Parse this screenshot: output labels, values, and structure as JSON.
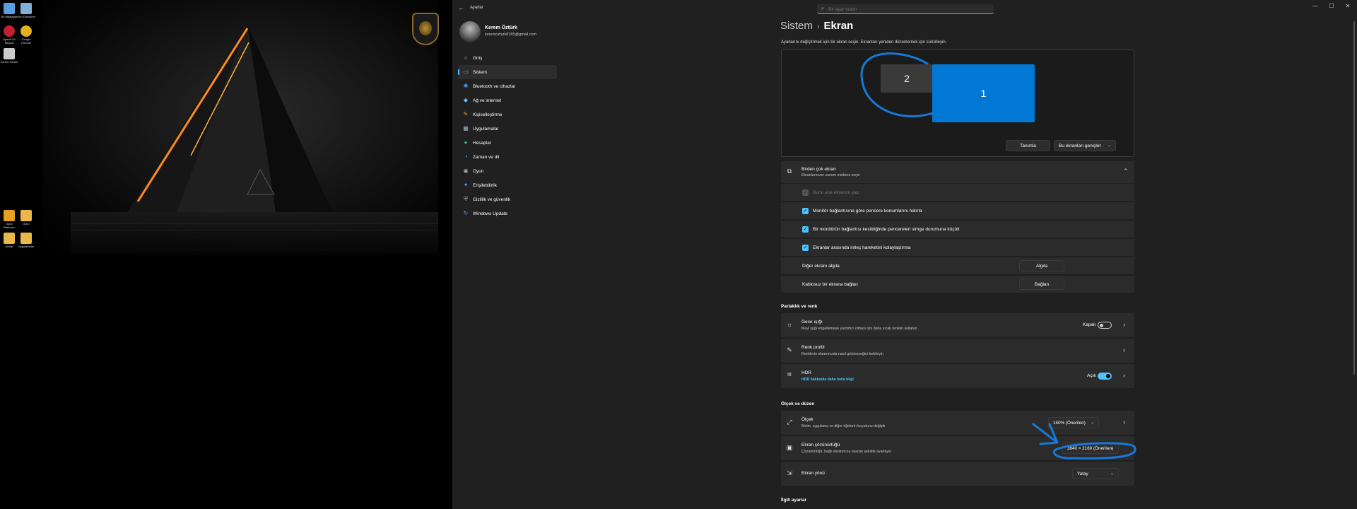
{
  "desktop": {
    "icons": [
      {
        "label": "Bu bilgisayar",
        "color": "#5aa0e0"
      },
      {
        "label": "Geri Dönüşüm",
        "color": "#7fb0d8"
      },
      {
        "label": "Opera GX Tarayıcı",
        "color": "#c2222f"
      },
      {
        "label": "Google Chrome",
        "color": "#e0b020"
      },
      {
        "label": "Kerem Ozturk",
        "color": "#cccccc"
      },
      {
        "label": "Oyun Platformu",
        "color": "#e8a020"
      },
      {
        "label": "Oyun",
        "color": "#e8b84a"
      },
      {
        "label": "Notlar",
        "color": "#e8b84a"
      },
      {
        "label": "Uygulamalar",
        "color": "#e8b84a"
      }
    ]
  },
  "window": {
    "title": "Ayarlar",
    "search_placeholder": "Bir ayar bulun",
    "controls": {
      "minimize": "—",
      "maximize": "☐",
      "close": "✕"
    }
  },
  "profile": {
    "name": "Kerem Öztürk",
    "email": "keremozturk8155@gmail.com"
  },
  "nav": [
    {
      "label": "Giriş",
      "icon": "home-icon",
      "glyph": "⌂",
      "color": "#e8a040"
    },
    {
      "label": "Sistem",
      "icon": "system-icon",
      "glyph": "▭",
      "color": "#4cc2ff",
      "active": true
    },
    {
      "label": "Bluetooth ve cihazlar",
      "icon": "bluetooth-icon",
      "glyph": "✱",
      "color": "#4c9cff"
    },
    {
      "label": "Ağ ve internet",
      "icon": "wifi-icon",
      "glyph": "◆",
      "color": "#6cb8ff"
    },
    {
      "label": "Kişiselleştirme",
      "icon": "brush-icon",
      "glyph": "✎",
      "color": "#f0a030"
    },
    {
      "label": "Uygulamalar",
      "icon": "apps-icon",
      "glyph": "▦",
      "color": "#9bb0c8"
    },
    {
      "label": "Hesaplar",
      "icon": "person-icon",
      "glyph": "●",
      "color": "#40c880"
    },
    {
      "label": "Zaman ve dil",
      "icon": "globe-clock-icon",
      "glyph": "◔",
      "color": "#4cc2ff"
    },
    {
      "label": "Oyun",
      "icon": "gamepad-icon",
      "glyph": "◉",
      "color": "#aaaaaa"
    },
    {
      "label": "Erişilebilirlik",
      "icon": "accessibility-icon",
      "glyph": "✦",
      "color": "#4c9cff"
    },
    {
      "label": "Gizlilik ve güvenlik",
      "icon": "shield-icon",
      "glyph": "⛨",
      "color": "#aaaaaa"
    },
    {
      "label": "Windows Update",
      "icon": "update-icon",
      "glyph": "↻",
      "color": "#4c9cff"
    }
  ],
  "breadcrumb": {
    "parent": "Sistem",
    "separator": "›",
    "current": "Ekran"
  },
  "hint": "Ayarlarını değiştirmek için bir ekran seçin. Ekranları yeniden düzenlemek için sürükleyin.",
  "monitors": {
    "m2": "2",
    "m1": "1",
    "identify": "Tanımla",
    "extend": "Bu ekranları genişlet"
  },
  "multi_display": {
    "title": "Birden çok ekran",
    "subtitle": "Ekranlarınızın sunum modunu seçin",
    "make_main": "Bunu ana ekranım yap",
    "remember_windows": "Monitör bağlantısına göre pencere konumlarını hatırla",
    "minimize_windows": "Bir monitörün bağlantısı kesildiğinde pencereleri simge durumuna küçült",
    "ease_cursor": "Ekranlar arasında imleç hareketini kolaylaştırma",
    "detect_label": "Diğer ekranı algıla",
    "detect_button": "Algıla",
    "wireless_label": "Kablosuz bir ekrana bağlan",
    "wireless_button": "Bağlan"
  },
  "brightness_section": "Parlaklık ve renk",
  "night_light": {
    "title": "Gece ışığı",
    "subtitle": "Mavi ışığı engellemeye yardımcı olması için daha sıcak renkler kullanın",
    "state": "Kapalı",
    "on": false
  },
  "color_profile": {
    "title": "Renk profili",
    "subtitle": "Renklerin ekranınızda nasıl görüneceğini belirleyin"
  },
  "hdr": {
    "title": "HDR",
    "link": "HDR hakkında daha fazla bilgi",
    "state": "Açık",
    "on": true
  },
  "scale_section": "Ölçek ve düzen",
  "scale": {
    "title": "Ölçek",
    "subtitle": "Metin, uygulama ve diğer öğelerin boyutunu değiştir",
    "value": "150% (Önerilen)"
  },
  "resolution": {
    "title": "Ekran çözünürlüğü",
    "subtitle": "Çözünürlüğü, bağlı ekranınıza uyacak şekilde ayarlayın",
    "value": "3840 × 2160 (Önerilen)"
  },
  "orientation": {
    "title": "Ekran yönü",
    "value": "Yatay"
  },
  "related_section": "İlgili ayarlar",
  "colors": {
    "accent": "#4cc2ff",
    "monitor_selected": "#0078d4",
    "annotation": "#1679d8"
  }
}
